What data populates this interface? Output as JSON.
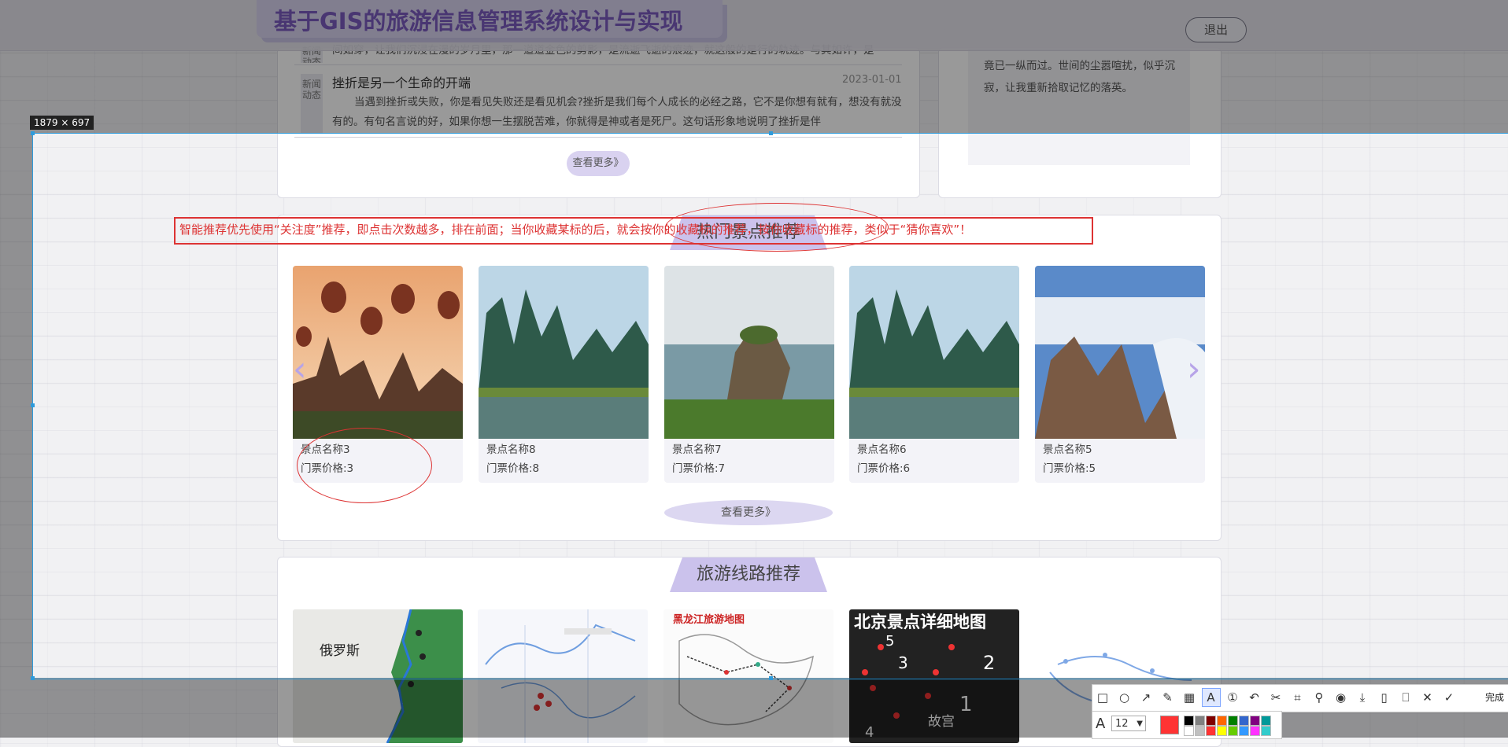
{
  "header": {
    "title": "基于GIS的旅游信息管理系统设计与实现",
    "logout_label": "退出"
  },
  "news": {
    "items": [
      {
        "tag": "新闻动态",
        "title": "",
        "date": "",
        "body": "间如穿，让我们沉浸在漫的岁月里，那一道道金色的剪影，是流逝飞逝的痕迹，就这般的是行的轨迹。与其如许，是"
      },
      {
        "tag": "新闻动态",
        "title": "挫折是另一个生命的开端",
        "date": "2023-01-01",
        "body": "当遇到挫折或失败，你是看见失败还是看见机会?挫折是我们每个人成长的必经之路，它不是你想有就有，想没有就没有的。有句名言说的好，如果你想一生摆脱苦难，你就得是神或者是死尸。这句话形象地说明了挫折是伴"
      }
    ],
    "more_label": "查看更多》"
  },
  "right_panel": {
    "text": "竟已一纵而过。世间的尘嚣喧扰，似乎沉寂，让我重新拾取记忆的落英。"
  },
  "spots": {
    "title": "热门景点推荐",
    "more_label": "查看更多》",
    "cards": [
      {
        "name": "景点名称3",
        "price": "门票价格:3",
        "scene": "balloons"
      },
      {
        "name": "景点名称8",
        "price": "门票价格:8",
        "scene": "karst"
      },
      {
        "name": "景点名称7",
        "price": "门票价格:7",
        "scene": "sea-rock"
      },
      {
        "name": "景点名称6",
        "price": "门票价格:6",
        "scene": "karst"
      },
      {
        "name": "景点名称5",
        "price": "门票价格:5",
        "scene": "mountains"
      }
    ]
  },
  "routes": {
    "title": "旅游线路推荐",
    "maps": [
      {
        "label": "俄罗斯",
        "style": "green-map"
      },
      {
        "label": "",
        "style": "road-map"
      },
      {
        "label": "黑龙江旅游地图",
        "style": "route-map"
      },
      {
        "label": "北京景点详细地图",
        "style": "dark-map",
        "markers": [
          "5",
          "3",
          "2",
          "1",
          "4"
        ],
        "place": "故宫"
      },
      {
        "label": "",
        "style": "line-map"
      }
    ]
  },
  "annotation": {
    "text": "智能推荐优先使用“关注度”推荐，即点击次数越多，排在前面；当你收藏某标的后，就会按你的收藏标的推荐，按你收藏标的推荐，类似于“猜你喜欢”！",
    "color": "#dd3333"
  },
  "capture": {
    "size_label": "1879 × 697",
    "font_size": "12",
    "done_label": "完成",
    "current_color": "#ff3333",
    "palette": [
      "#000000",
      "#808080",
      "#800000",
      "#ff6600",
      "#008000",
      "#3366cc",
      "#800080",
      "#009999",
      "#ffffff",
      "#c0c0c0",
      "#ff3333",
      "#ffff00",
      "#66cc00",
      "#3399ff",
      "#ff33ff",
      "#33cccc"
    ],
    "tools": [
      "rect-icon",
      "ellipse-icon",
      "arrow-icon",
      "pen-icon",
      "mosaic-icon",
      "text-icon",
      "number-icon",
      "undo-icon",
      "cut-icon",
      "ocr-icon",
      "pin-icon",
      "record-icon",
      "download-icon",
      "phone-icon",
      "bookmark-icon",
      "close-icon",
      "confirm-icon"
    ]
  }
}
